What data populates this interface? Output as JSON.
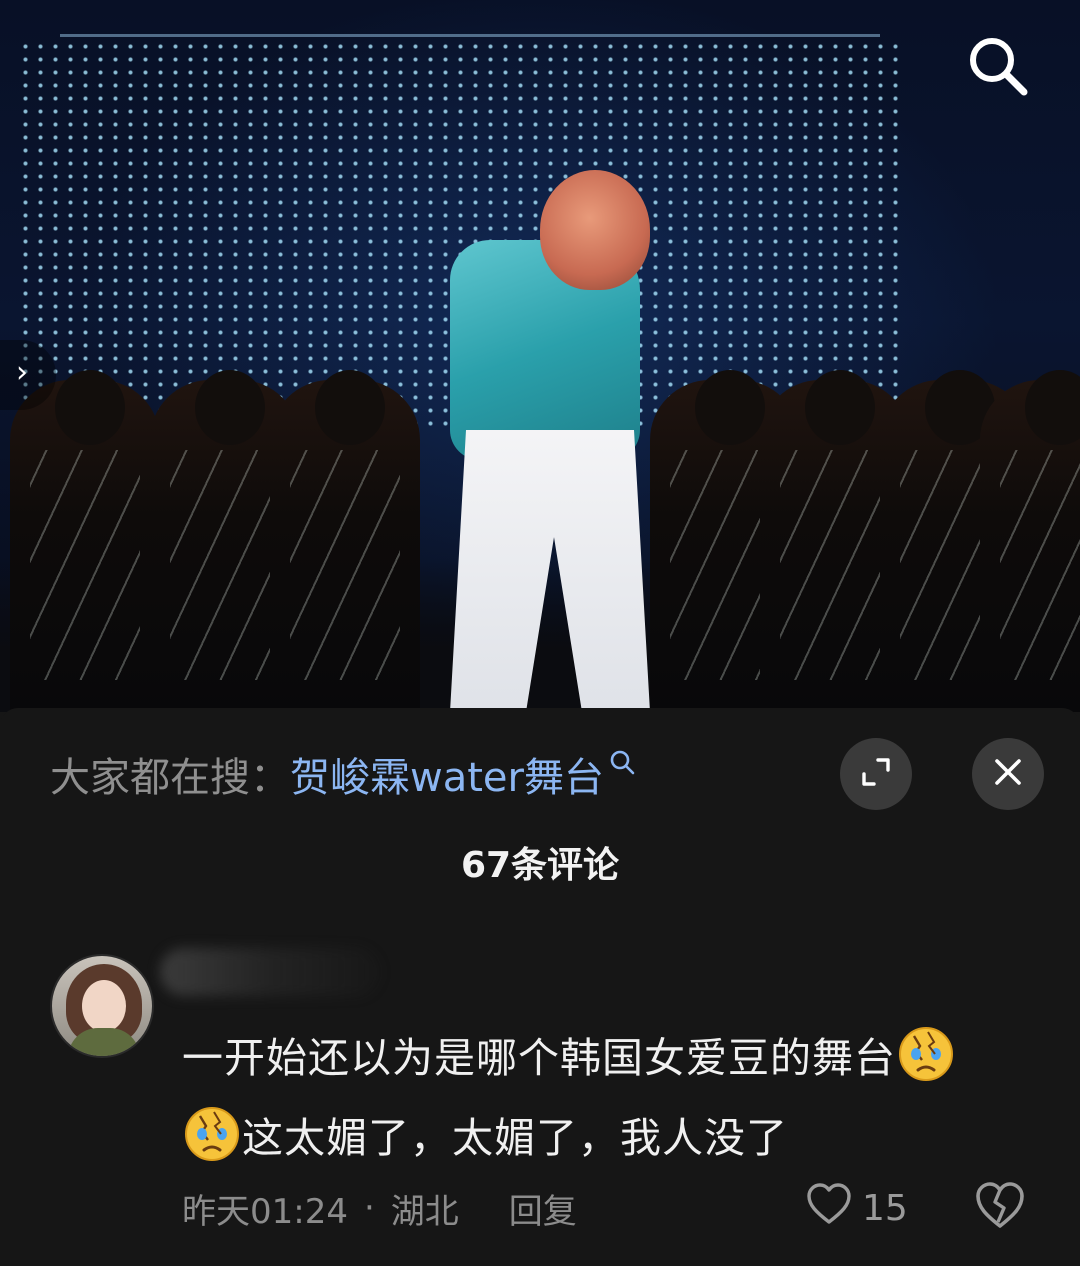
{
  "video": {
    "search_icon": "search-icon",
    "side_arrow_glyph": "›"
  },
  "sheet": {
    "trending_label": "大家都在搜：",
    "trending_query": "贺峻霖water舞台",
    "trending_icon": "search-icon",
    "expand_icon": "expand-icon",
    "close_icon": "close-icon",
    "comment_count": "67条评论"
  },
  "comment": {
    "avatar_icon": "avatar",
    "text_line1": "一开始还以为是哪个韩国女爱豆的舞台",
    "text_line2": "这太媚了，太媚了，我人没了",
    "emoji": "broken-heart-crying-emoji",
    "time": "昨天01:24",
    "separator": "·",
    "location": "湖北",
    "reply_label": "回复",
    "like_count": "15",
    "like_icon": "heart-outline-icon",
    "dislike_icon": "broken-heart-icon"
  },
  "colors": {
    "background": "#161616",
    "trending_query": "#8cb6f2",
    "muted_text": "#8c8c8c",
    "button_bg": "#3a3a3a"
  }
}
